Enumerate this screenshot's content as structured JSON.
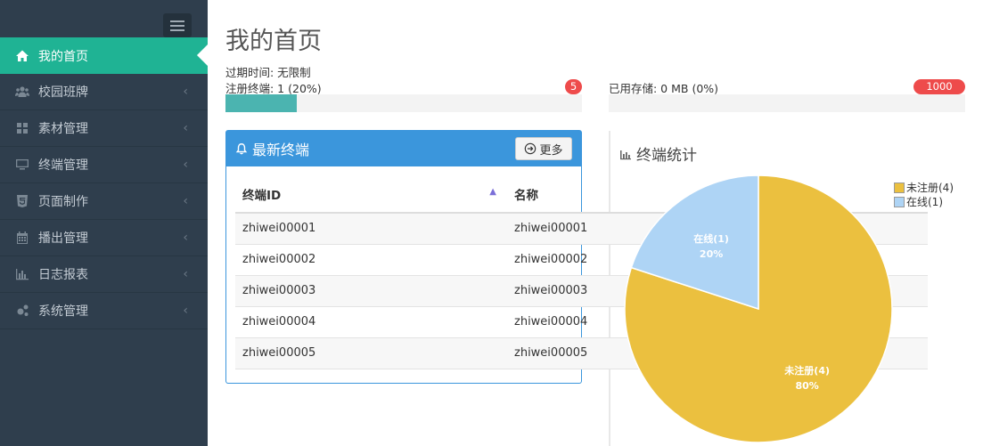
{
  "sidebar": {
    "items": [
      {
        "label": "我的首页",
        "icon": "home-icon",
        "active": true
      },
      {
        "label": "校园班牌",
        "icon": "users-icon"
      },
      {
        "label": "素材管理",
        "icon": "grid-icon"
      },
      {
        "label": "终端管理",
        "icon": "monitor-icon"
      },
      {
        "label": "页面制作",
        "icon": "html5-icon"
      },
      {
        "label": "播出管理",
        "icon": "calendar-icon"
      },
      {
        "label": "日志报表",
        "icon": "bar-chart-icon"
      },
      {
        "label": "系统管理",
        "icon": "gears-icon"
      }
    ],
    "arrow": "‹"
  },
  "page": {
    "title": "我的首页",
    "expire": "过期时间: 无限制",
    "registered": "注册终端: 1 (20%)",
    "registered_badge": "5",
    "registered_progress": 0.2,
    "storage": "已用存储: 0 MB (0%)",
    "storage_badge": "1000 MB",
    "storage_progress": 0
  },
  "panel": {
    "title": "最新终端",
    "more": "更多",
    "columns": [
      "终端ID",
      "名称"
    ],
    "rows": [
      [
        "zhiwei00001",
        "zhiwei00001"
      ],
      [
        "zhiwei00002",
        "zhiwei00002"
      ],
      [
        "zhiwei00003",
        "zhiwei00003"
      ],
      [
        "zhiwei00004",
        "zhiwei00004"
      ],
      [
        "zhiwei00005",
        "zhiwei00005"
      ]
    ]
  },
  "chart_title": "终端统计",
  "chart_data": {
    "type": "pie",
    "title": "终端统计",
    "slices": [
      {
        "label": "未注册(4)",
        "value": 80,
        "pct": "80%",
        "color": "#ebc03f"
      },
      {
        "label": "在线(1)",
        "value": 20,
        "pct": "20%",
        "color": "#aed4f5"
      }
    ],
    "legend": "top-right"
  }
}
